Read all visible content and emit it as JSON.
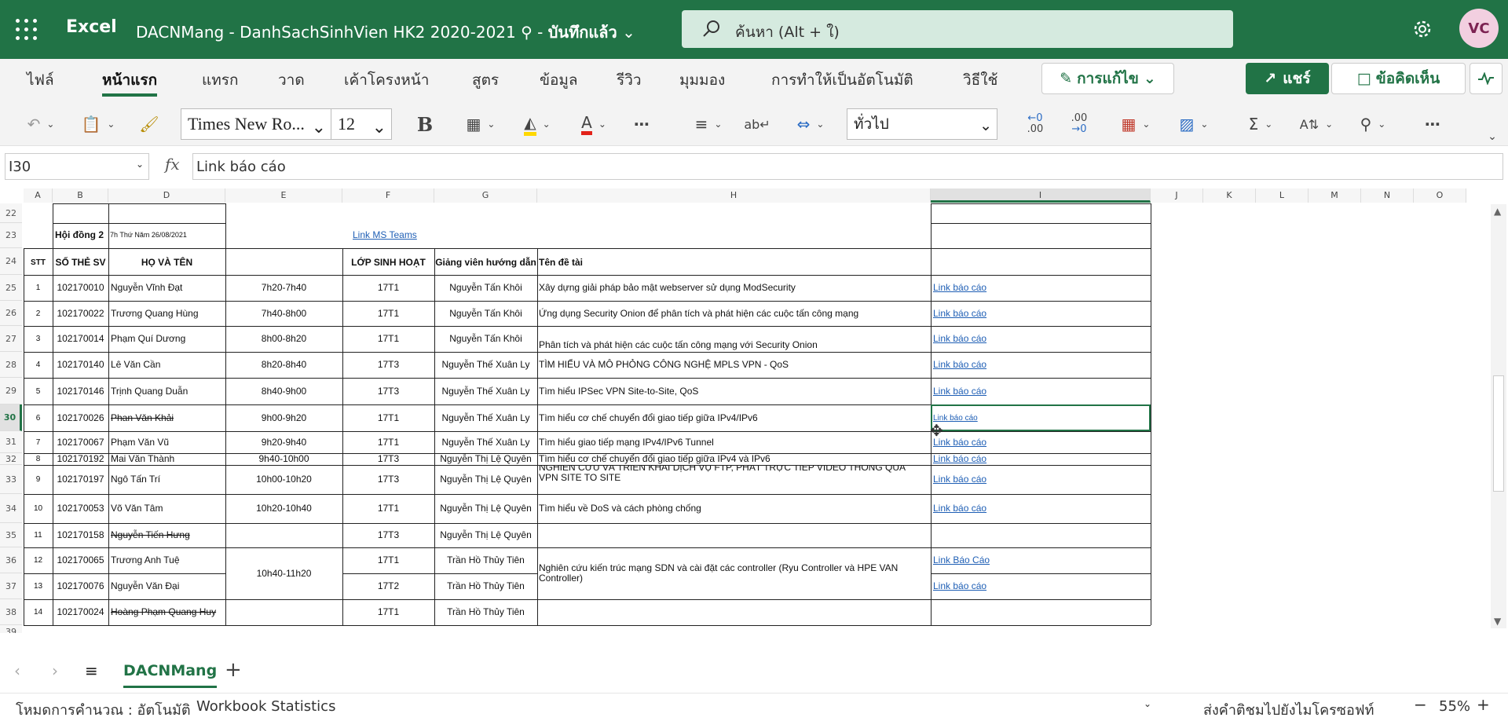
{
  "app": {
    "name": "Excel",
    "doc_title": "DACNMang - DanhSachSinhVien HK2 2020-2021",
    "save_state": "บันทึกแล้ว",
    "user_initials": "VC"
  },
  "search": {
    "placeholder": "ค้นหา (Alt + ใ)"
  },
  "menu": {
    "tabs": [
      "ไฟล์",
      "หน้าแรก",
      "แทรก",
      "วาด",
      "เค้าโครงหน้า",
      "สูตร",
      "ข้อมูล",
      "รีวิว",
      "มุมมอง",
      "การทำให้เป็นอัตโนมัติ",
      "วิธีใช้"
    ],
    "active_tab": "หน้าแรก",
    "edit_label": "การแก้ไข",
    "share_label": "แชร์",
    "comments_label": "ข้อคิดเห็น"
  },
  "ribbon": {
    "font_name": "Times New Ro...",
    "font_size": "12",
    "number_format": "ทั่วไป",
    "bold": "B",
    "font_color_letter": "A",
    "dec_inc": ".00",
    "dec_dec": ".00",
    "accent_fill": "#ffd800",
    "accent_font": "#e2231a"
  },
  "formula": {
    "name_box": "I30",
    "fx": "fx",
    "value": "Link báo cáo"
  },
  "columns": [
    "A",
    "B",
    "D",
    "E",
    "F",
    "G",
    "H",
    "I",
    "J",
    "K",
    "L",
    "M",
    "N",
    "O"
  ],
  "selected_column": "I",
  "selected_row": "30",
  "row_numbers": [
    "22",
    "23",
    "24",
    "25",
    "26",
    "27",
    "28",
    "29",
    "30",
    "31",
    "32",
    "33",
    "34",
    "35",
    "36",
    "37",
    "38",
    "39"
  ],
  "sheet": {
    "hoi_dong": "Hội đồng 2",
    "date": "7h Thứ Năm 26/08/2021",
    "teams_link": "Link MS Teams",
    "headers": {
      "stt": "STT",
      "so_the": "SỐ THẺ SV",
      "ho_ten": "HỌ VÀ TÊN",
      "lop": "LỚP SINH HOẠT",
      "gvhd": "Giảng viên hướng dẫn",
      "de_tai": "Tên đề tài"
    },
    "rows": [
      {
        "stt": "1",
        "id": "102170010",
        "name": "Nguyễn Vĩnh Đạt",
        "time": "7h20-7h40",
        "cls": "17T1",
        "gv": "Nguyễn Tấn Khôi",
        "topic": "Xây dựng giải pháp bảo mật webserver sử dụng ModSecurity",
        "link": "Link báo cáo"
      },
      {
        "stt": "2",
        "id": "102170022",
        "name": "Trương Quang Hùng",
        "time": "7h40-8h00",
        "cls": "17T1",
        "gv": "Nguyễn Tấn Khôi",
        "topic": "Ứng dụng Security Onion để phân tích và phát hiện các cuộc tấn công mạng",
        "link": "Link báo cáo"
      },
      {
        "stt": "3",
        "id": "102170014",
        "name": "Phạm Quí Dương",
        "time": "8h00-8h20",
        "cls": "17T1",
        "gv": "Nguyễn Tấn Khôi",
        "topic": "Phân tích và phát hiện các cuộc tấn công mạng với Security Onion",
        "link": "Link báo cáo"
      },
      {
        "stt": "4",
        "id": "102170140",
        "name": "Lê Văn Cần",
        "time": "8h20-8h40",
        "cls": "17T3",
        "gv": "Nguyễn Thế Xuân Ly",
        "topic": "TÌM HIỂU VÀ MÔ PHỎNG CÔNG NGHỆ MPLS VPN - QoS",
        "link": "Link báo cáo"
      },
      {
        "stt": "5",
        "id": "102170146",
        "name": "Trịnh Quang Duẫn",
        "time": "8h40-9h00",
        "cls": "17T3",
        "gv": "Nguyễn Thế Xuân Ly",
        "topic": "Tìm hiểu IPSec VPN Site-to-Site, QoS",
        "link": "Link báo cáo"
      },
      {
        "stt": "6",
        "id": "102170026",
        "name": "Phan Văn Khải",
        "time": "9h00-9h20",
        "cls": "17T1",
        "gv": "Nguyễn Thế Xuân Ly",
        "topic": "Tìm hiểu cơ chế chuyển đổi giao tiếp giữa IPv4/IPv6",
        "link": "Link báo cáo"
      },
      {
        "stt": "7",
        "id": "102170067",
        "name": "Phạm Văn Vũ",
        "time": "9h20-9h40",
        "cls": "17T1",
        "gv": "Nguyễn Thế Xuân Ly",
        "topic": "Tìm hiểu giao tiếp mạng IPv4/IPv6 Tunnel",
        "link": "Link báo cáo"
      },
      {
        "stt": "8",
        "id": "102170192",
        "name": "Mai Văn Thành",
        "time": "9h40-10h00",
        "cls": "17T3",
        "gv": "Nguyễn Thị Lệ Quyên",
        "topic": "Tìm hiểu cơ chế chuyển đổi giao tiếp giữa IPv4 và IPv6",
        "link": "Link báo cáo"
      },
      {
        "stt": "9",
        "id": "102170197",
        "name": "Ngô Tấn Trí",
        "time": "10h00-10h20",
        "cls": "17T3",
        "gv": "Nguyễn Thị Lệ Quyên",
        "topic": "NGHIÊN CỨU VÀ TRIỂN KHAI DỊCH VỤ FTP, PHÁT TRỰC TIẾP VIDEO THÔNG QUA",
        "topic2": "VPN SITE TO SITE",
        "link": "Link báo cáo"
      },
      {
        "stt": "10",
        "id": "102170053",
        "name": "Võ Văn Tâm",
        "time": "10h20-10h40",
        "cls": "17T1",
        "gv": "Nguyễn Thị Lệ Quyên",
        "topic": "Tìm hiểu về DoS và cách phòng chống",
        "link": "Link báo cáo"
      },
      {
        "stt": "11",
        "id": "102170158",
        "name": "Nguyễn Tiến Hưng",
        "time": "",
        "cls": "17T3",
        "gv": "Nguyễn Thị Lệ Quyên",
        "topic": "",
        "link": ""
      },
      {
        "stt": "12",
        "id": "102170065",
        "name": "Trương Anh Tuệ",
        "time": "10h40-11h20",
        "cls": "17T1",
        "gv": "Trần Hồ Thủy Tiên",
        "topic": "Nghiên cứu kiến trúc mạng SDN và cài đặt các controller (Ryu Controller và HPE VAN",
        "topic2": "Controller)",
        "link": "Link Báo Cáo"
      },
      {
        "stt": "13",
        "id": "102170076",
        "name": "Nguyễn Văn Đại",
        "time": "",
        "cls": "17T2",
        "gv": "Trần Hồ Thủy Tiên",
        "topic": "",
        "link": "Link báo cáo"
      },
      {
        "stt": "14",
        "id": "102170024",
        "name": "Hoàng Phạm Quang Huy",
        "time": "",
        "cls": "17T1",
        "gv": "Trần Hồ Thủy Tiên",
        "topic": "",
        "link": ""
      }
    ]
  },
  "sheet_tab": "DACNMang",
  "status": {
    "calc_mode": "โหมดการคำนวณ : อัตโนมัติ",
    "workbook_stats": "Workbook Statistics",
    "feedback": "ส่งคำติชมไปยังไมโครซอฟท์",
    "zoom": "55%"
  }
}
